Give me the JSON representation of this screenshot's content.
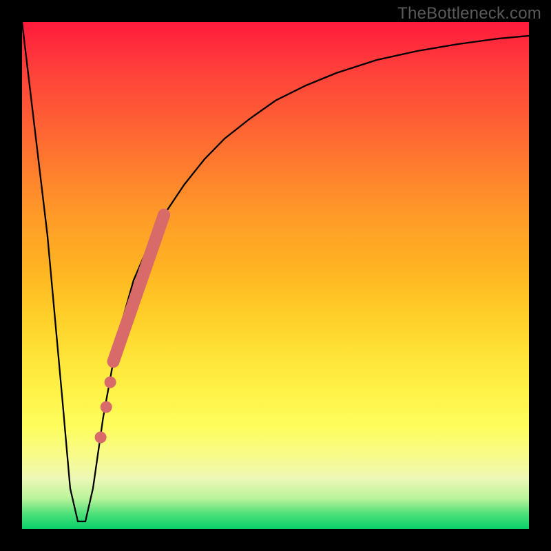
{
  "watermark": "TheBottleneck.com",
  "chart_data": {
    "type": "line",
    "title": "",
    "xlabel": "",
    "ylabel": "",
    "xlim": [
      0,
      100
    ],
    "ylim": [
      0,
      100
    ],
    "series": [
      {
        "name": "bottleneck-curve",
        "x": [
          0,
          5,
          8,
          9.5,
          11,
          12.5,
          14,
          16,
          18,
          20,
          22,
          25,
          28,
          32,
          36,
          40,
          45,
          50,
          56,
          62,
          70,
          78,
          86,
          94,
          100
        ],
        "values": [
          100,
          58,
          25,
          8,
          1.5,
          1.5,
          8,
          22,
          33,
          42,
          49,
          56,
          62,
          68,
          73,
          77,
          81,
          84.5,
          87.5,
          90,
          92.5,
          94.3,
          95.7,
          96.7,
          97.3
        ]
      }
    ],
    "highlight_segment": {
      "name": "overlay-thick",
      "x": [
        18,
        28
      ],
      "y": [
        33,
        62
      ],
      "color": "#d86a6a"
    },
    "highlight_dots": {
      "name": "overlay-dots",
      "x": [
        15.5,
        16.6,
        17.4
      ],
      "y": [
        18,
        24,
        29
      ],
      "color": "#d86a6a"
    },
    "background_gradient": [
      {
        "pos": 0,
        "color": "#ff1a3c"
      },
      {
        "pos": 0.5,
        "color": "#ffcf28"
      },
      {
        "pos": 0.9,
        "color": "#eef8b6"
      },
      {
        "pos": 1.0,
        "color": "#06cf6a"
      }
    ]
  }
}
